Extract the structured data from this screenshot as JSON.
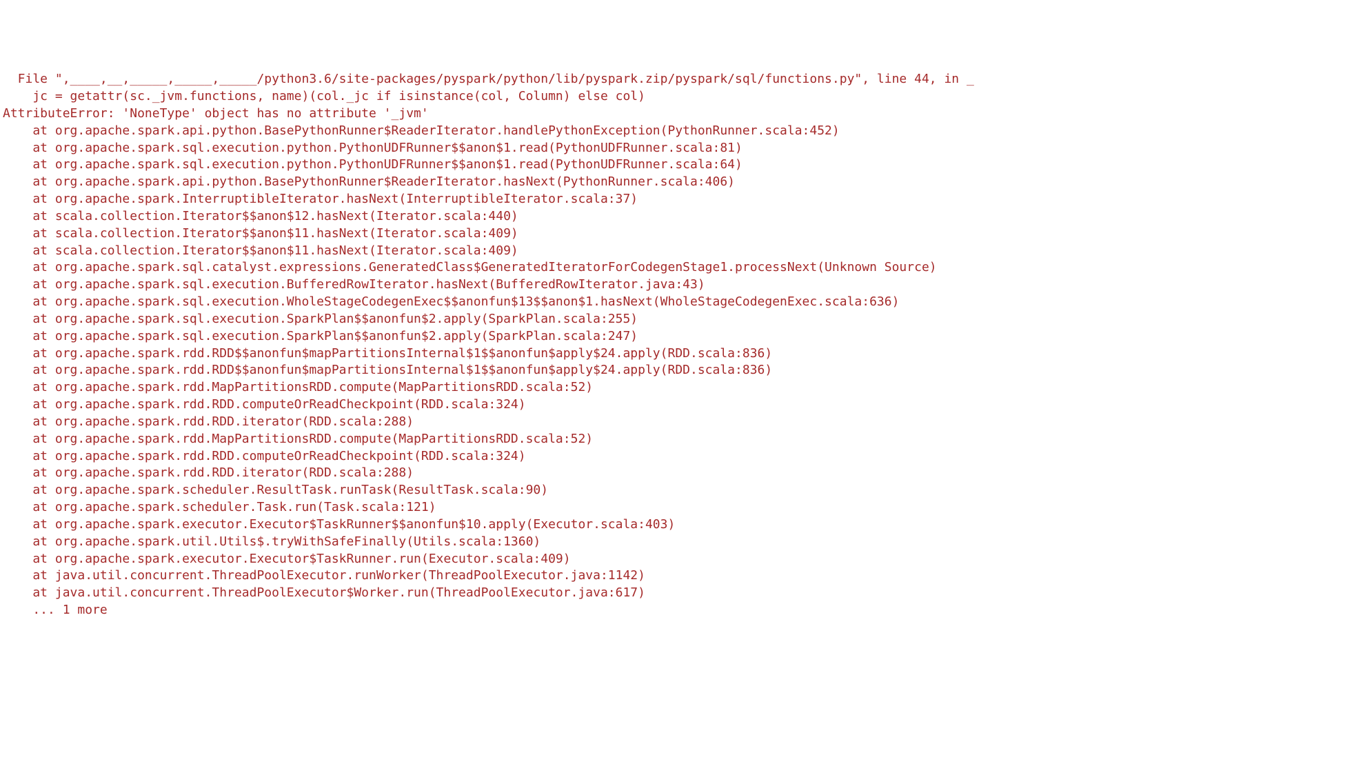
{
  "traceback": {
    "file_line": "  File \",____,__,_____,_____,_____/python3.6/site-packages/pyspark/python/lib/pyspark.zip/pyspark/sql/functions.py\", line 44, in _",
    "code_line": "    jc = getattr(sc._jvm.functions, name)(col._jc if isinstance(col, Column) else col)",
    "error_line": "AttributeError: 'NoneType' object has no attribute '_jvm'",
    "blank": "",
    "stack": [
      "    at org.apache.spark.api.python.BasePythonRunner$ReaderIterator.handlePythonException(PythonRunner.scala:452)",
      "    at org.apache.spark.sql.execution.python.PythonUDFRunner$$anon$1.read(PythonUDFRunner.scala:81)",
      "    at org.apache.spark.sql.execution.python.PythonUDFRunner$$anon$1.read(PythonUDFRunner.scala:64)",
      "    at org.apache.spark.api.python.BasePythonRunner$ReaderIterator.hasNext(PythonRunner.scala:406)",
      "    at org.apache.spark.InterruptibleIterator.hasNext(InterruptibleIterator.scala:37)",
      "    at scala.collection.Iterator$$anon$12.hasNext(Iterator.scala:440)",
      "    at scala.collection.Iterator$$anon$11.hasNext(Iterator.scala:409)",
      "    at scala.collection.Iterator$$anon$11.hasNext(Iterator.scala:409)",
      "    at org.apache.spark.sql.catalyst.expressions.GeneratedClass$GeneratedIteratorForCodegenStage1.processNext(Unknown Source)",
      "    at org.apache.spark.sql.execution.BufferedRowIterator.hasNext(BufferedRowIterator.java:43)",
      "    at org.apache.spark.sql.execution.WholeStageCodegenExec$$anonfun$13$$anon$1.hasNext(WholeStageCodegenExec.scala:636)",
      "    at org.apache.spark.sql.execution.SparkPlan$$anonfun$2.apply(SparkPlan.scala:255)",
      "    at org.apache.spark.sql.execution.SparkPlan$$anonfun$2.apply(SparkPlan.scala:247)",
      "    at org.apache.spark.rdd.RDD$$anonfun$mapPartitionsInternal$1$$anonfun$apply$24.apply(RDD.scala:836)",
      "    at org.apache.spark.rdd.RDD$$anonfun$mapPartitionsInternal$1$$anonfun$apply$24.apply(RDD.scala:836)",
      "    at org.apache.spark.rdd.MapPartitionsRDD.compute(MapPartitionsRDD.scala:52)",
      "    at org.apache.spark.rdd.RDD.computeOrReadCheckpoint(RDD.scala:324)",
      "    at org.apache.spark.rdd.RDD.iterator(RDD.scala:288)",
      "    at org.apache.spark.rdd.MapPartitionsRDD.compute(MapPartitionsRDD.scala:52)",
      "    at org.apache.spark.rdd.RDD.computeOrReadCheckpoint(RDD.scala:324)",
      "    at org.apache.spark.rdd.RDD.iterator(RDD.scala:288)",
      "    at org.apache.spark.scheduler.ResultTask.runTask(ResultTask.scala:90)",
      "    at org.apache.spark.scheduler.Task.run(Task.scala:121)",
      "    at org.apache.spark.executor.Executor$TaskRunner$$anonfun$10.apply(Executor.scala:403)",
      "    at org.apache.spark.util.Utils$.tryWithSafeFinally(Utils.scala:1360)",
      "    at org.apache.spark.executor.Executor$TaskRunner.run(Executor.scala:409)",
      "    at java.util.concurrent.ThreadPoolExecutor.runWorker(ThreadPoolExecutor.java:1142)",
      "    at java.util.concurrent.ThreadPoolExecutor$Worker.run(ThreadPoolExecutor.java:617)",
      "    ... 1 more"
    ]
  }
}
